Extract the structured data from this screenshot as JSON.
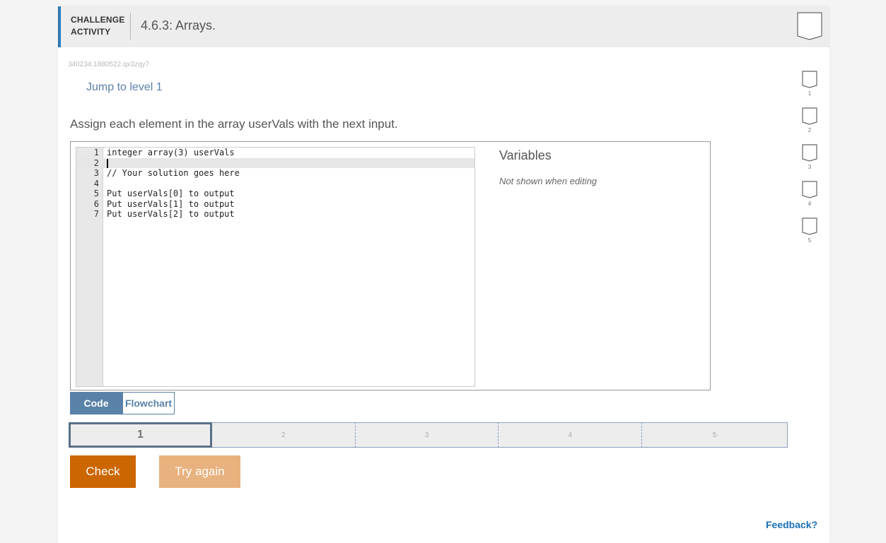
{
  "header": {
    "type_line1": "CHALLENGE",
    "type_line2": "ACTIVITY",
    "title": "4.6.3: Arrays."
  },
  "activity_id": "340234.1880522.qx3zqy7",
  "jump_link": "Jump to level 1",
  "prompt": "Assign each element in the array userVals with the next input.",
  "code": {
    "lines": [
      {
        "num": "1",
        "text": "integer array(3) userVals"
      },
      {
        "num": "2",
        "text": ""
      },
      {
        "num": "3",
        "text": "// Your solution goes here"
      },
      {
        "num": "4",
        "text": ""
      },
      {
        "num": "5",
        "text": "Put userVals[0] to output"
      },
      {
        "num": "6",
        "text": "Put userVals[1] to output"
      },
      {
        "num": "7",
        "text": "Put userVals[2] to output"
      }
    ],
    "active_line": 2
  },
  "variables": {
    "title": "Variables",
    "note": "Not shown when editing"
  },
  "view_toggle": {
    "code": "Code",
    "flowchart": "Flowchart",
    "selected": "Code"
  },
  "levels": [
    "1",
    "2",
    "3",
    "4",
    "5"
  ],
  "current_level": "1",
  "buttons": {
    "check": "Check",
    "try_again": "Try again"
  },
  "feedback": "Feedback?",
  "progress": [
    "1",
    "2",
    "3",
    "4",
    "5"
  ],
  "colors": {
    "accent": "#2b7bb9",
    "check_button": "#cc6600",
    "try_again_button": "#e8b27f",
    "toggle_active": "#5a82a8",
    "link": "#5a7fa8"
  }
}
